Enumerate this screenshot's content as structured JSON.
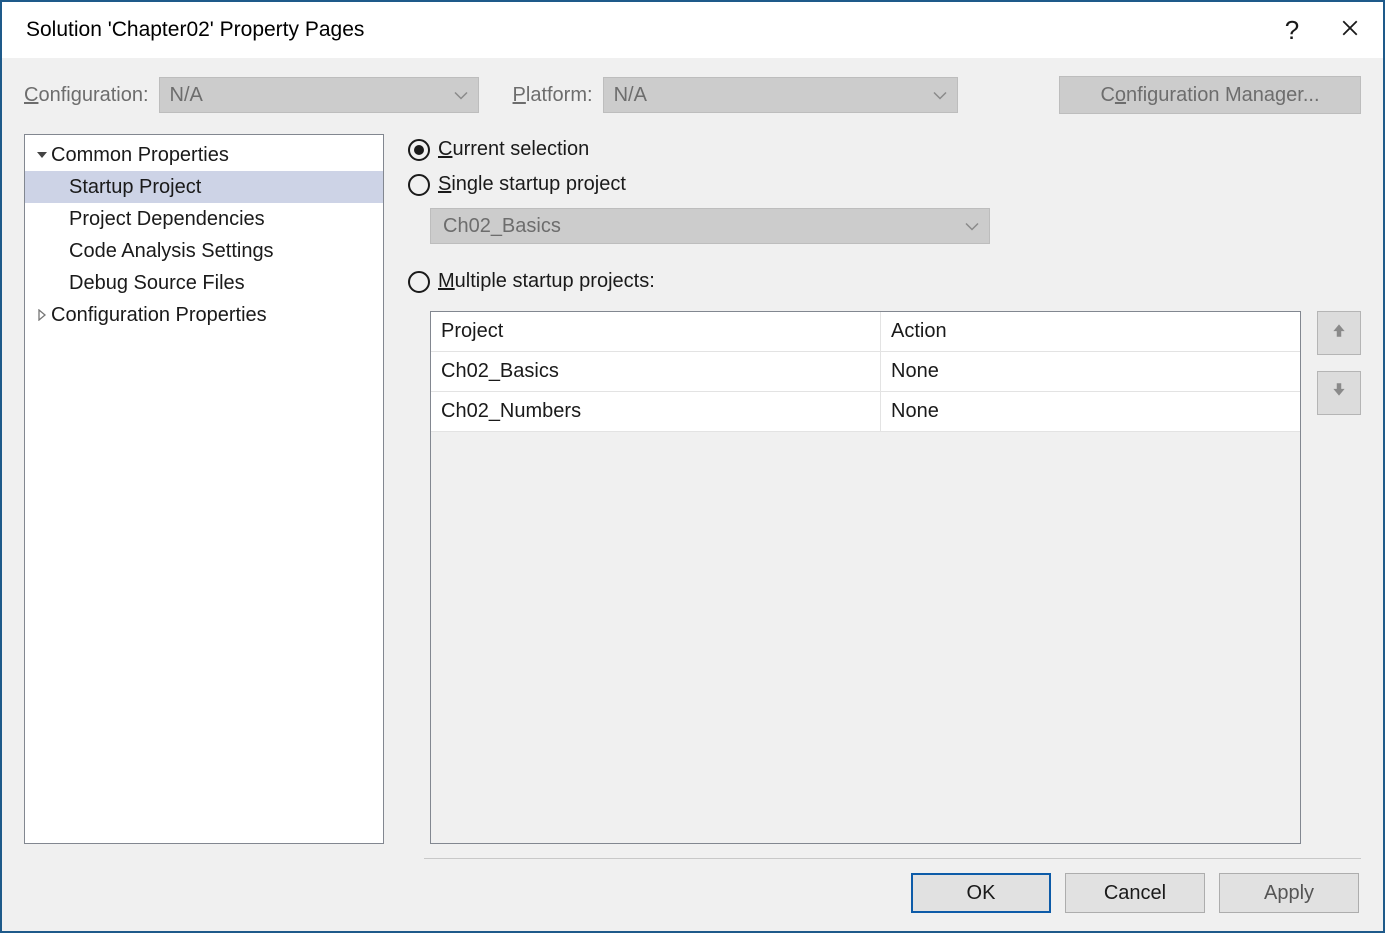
{
  "title": "Solution 'Chapter02' Property Pages",
  "help_glyph": "?",
  "config_bar": {
    "configuration_label_pre": "C",
    "configuration_label_post": "onfiguration:",
    "configuration_value": "N/A",
    "platform_label_pre": "P",
    "platform_label_post": "latform:",
    "platform_value": "N/A",
    "config_manager_pre": "C",
    "config_manager_u": "o",
    "config_manager_post": "nfiguration Manager..."
  },
  "tree": {
    "common_properties": "Common Properties",
    "items": [
      "Startup Project",
      "Project Dependencies",
      "Code Analysis Settings",
      "Debug Source Files"
    ],
    "configuration_properties": "Configuration Properties"
  },
  "startup": {
    "current_u": "C",
    "current_rest": "urrent selection",
    "single_u": "S",
    "single_rest": "ingle startup project",
    "single_value": "Ch02_Basics",
    "multi_u": "M",
    "multi_rest": "ultiple startup projects:",
    "grid": {
      "col_project": "Project",
      "col_action": "Action",
      "rows": [
        {
          "project": "Ch02_Basics",
          "action": "None"
        },
        {
          "project": "Ch02_Numbers",
          "action": "None"
        }
      ]
    }
  },
  "buttons": {
    "ok": "OK",
    "cancel": "Cancel",
    "apply": "Apply"
  }
}
